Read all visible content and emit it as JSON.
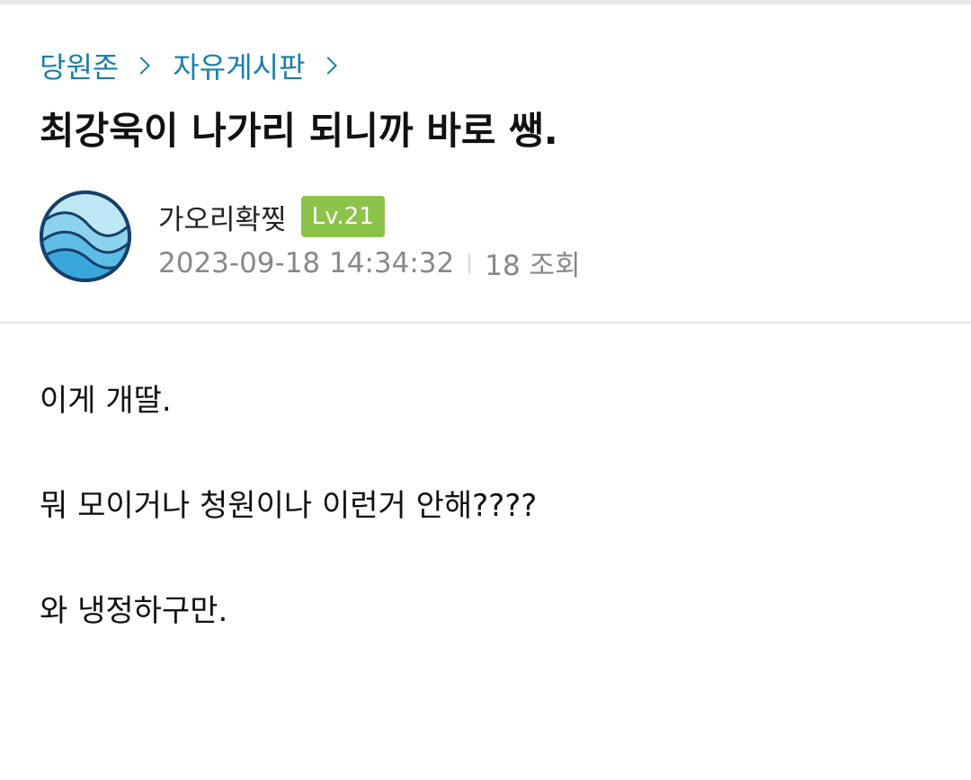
{
  "breadcrumb": {
    "items": [
      {
        "label": "당원존"
      },
      {
        "label": "자유게시판"
      }
    ]
  },
  "post": {
    "title": "최강욱이 나가리 되니까 바로 쌩.",
    "author": {
      "name": "가오리확찢",
      "level": "Lv.21",
      "avatar_icon": "wave-avatar-icon"
    },
    "datetime": "2023-09-18 14:34:32",
    "views": "18 조회",
    "body": [
      "이게 개딸.",
      "뭐 모이거나 청원이나 이런거 안해????",
      "와 냉정하구만."
    ]
  },
  "colors": {
    "breadcrumb": "#1a7fa8",
    "level_badge": "#8bc34a",
    "meta_text": "#888888"
  }
}
